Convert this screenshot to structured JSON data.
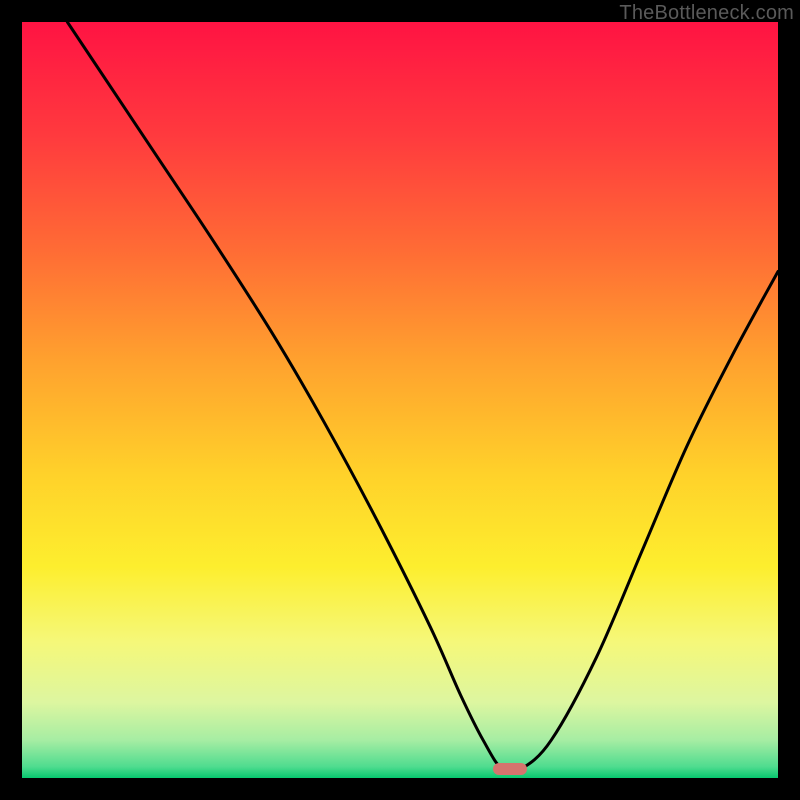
{
  "watermark": "TheBottleneck.com",
  "chart_data": {
    "type": "line",
    "title": "",
    "xlabel": "",
    "ylabel": "",
    "xlim": [
      0,
      100
    ],
    "ylim": [
      0,
      100
    ],
    "grid": false,
    "legend": false,
    "gradient_stops": [
      {
        "offset": 0.0,
        "color": "#ff1343"
      },
      {
        "offset": 0.15,
        "color": "#ff3a3e"
      },
      {
        "offset": 0.3,
        "color": "#ff6b35"
      },
      {
        "offset": 0.45,
        "color": "#ffa22e"
      },
      {
        "offset": 0.6,
        "color": "#ffd22a"
      },
      {
        "offset": 0.72,
        "color": "#fdee2e"
      },
      {
        "offset": 0.82,
        "color": "#f5f879"
      },
      {
        "offset": 0.9,
        "color": "#ddf6a0"
      },
      {
        "offset": 0.95,
        "color": "#a6eda3"
      },
      {
        "offset": 0.985,
        "color": "#4fdc8f"
      },
      {
        "offset": 1.0,
        "color": "#07c86f"
      }
    ],
    "series": [
      {
        "name": "bottleneck-curve",
        "color": "#000000",
        "x": [
          6,
          10,
          18,
          25,
          33,
          40,
          47,
          54,
          58,
          61,
          63.5,
          66,
          70,
          76,
          82,
          88,
          94,
          100
        ],
        "y": [
          100,
          94,
          82,
          71.5,
          59,
          47,
          34,
          20,
          11,
          5,
          1.2,
          1.2,
          5,
          16,
          30,
          44,
          56,
          67
        ]
      }
    ],
    "marker": {
      "x": 64.5,
      "y": 1.2,
      "width_pct": 4.5,
      "height_pct": 1.7,
      "color": "#d5746e"
    }
  }
}
